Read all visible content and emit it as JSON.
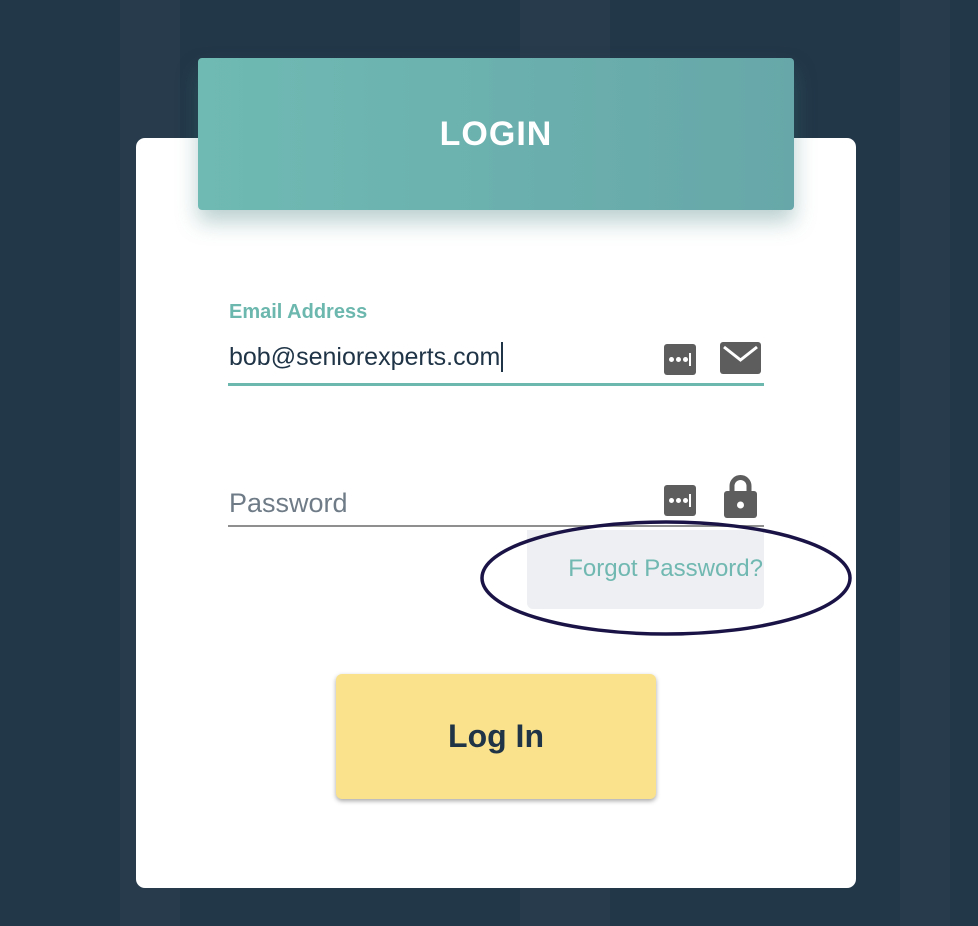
{
  "header": {
    "title": "LOGIN"
  },
  "email": {
    "label": "Email Address",
    "value": "bob@seniorexperts.com",
    "password_manager_icon": "password-manager-icon",
    "field_icon": "envelope-icon"
  },
  "password": {
    "placeholder": "Password",
    "value": "",
    "password_manager_icon": "password-manager-icon",
    "field_icon": "lock-icon"
  },
  "forgot": {
    "label": "Forgot Password?"
  },
  "submit": {
    "label": "Log In"
  },
  "colors": {
    "background": "#223748",
    "header_teal": "#6cb7ae",
    "button_yellow": "#fae28c",
    "text_dark": "#1f3446",
    "annotation_ellipse": "#1a1446"
  }
}
